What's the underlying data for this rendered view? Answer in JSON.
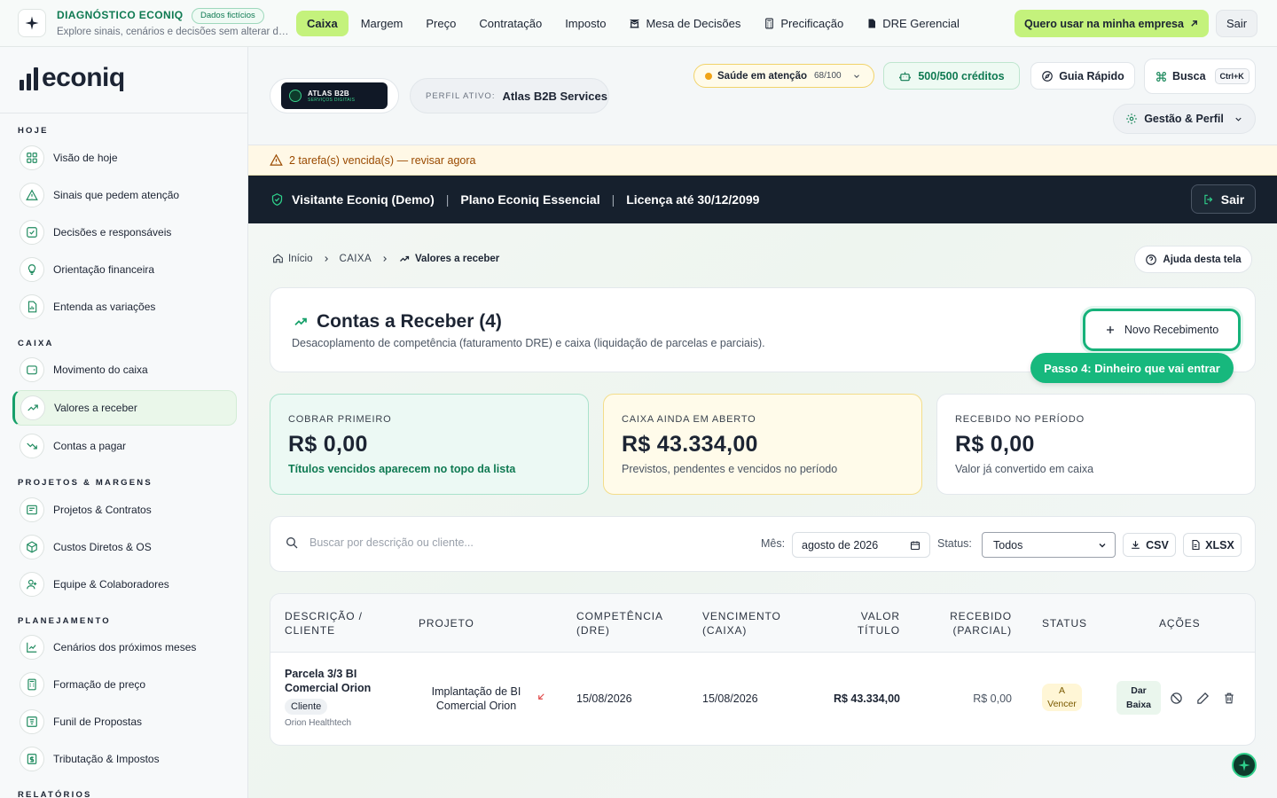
{
  "demo": {
    "title": "DIAGNÓSTICO ECONIQ",
    "badge": "Dados fictícios",
    "subtitle": "Explore sinais, cenários e decisões sem alterar da..."
  },
  "topnav": {
    "items": [
      {
        "label": "Caixa",
        "active": true
      },
      {
        "label": "Margem"
      },
      {
        "label": "Preço"
      },
      {
        "label": "Contratação"
      },
      {
        "label": "Imposto"
      },
      {
        "label": "Mesa de Decisões",
        "icon": "board-icon"
      },
      {
        "label": "Precificação",
        "icon": "calculator-icon"
      },
      {
        "label": "DRE Gerencial",
        "icon": "document-icon"
      }
    ],
    "cta": "Quero usar na minha empresa",
    "logout": "Sair"
  },
  "brand": {
    "name": "econiq"
  },
  "sidebar": {
    "sections": [
      {
        "label": "HOJE",
        "items": [
          {
            "label": "Visão de hoje",
            "icon": "grid-icon"
          },
          {
            "label": "Sinais que pedem atenção",
            "icon": "warning-icon"
          },
          {
            "label": "Decisões e responsáveis",
            "icon": "checkbox-icon"
          },
          {
            "label": "Orientação financeira",
            "icon": "lightbulb-icon"
          },
          {
            "label": "Entenda as variações",
            "icon": "file-chart-icon"
          }
        ]
      },
      {
        "label": "CAIXA",
        "items": [
          {
            "label": "Movimento do caixa",
            "icon": "wallet-icon"
          },
          {
            "label": "Valores a receber",
            "icon": "trend-up-icon",
            "active": true
          },
          {
            "label": "Contas a pagar",
            "icon": "trend-down-icon"
          }
        ]
      },
      {
        "label": "PROJETOS & MARGENS",
        "items": [
          {
            "label": "Projetos & Contratos",
            "icon": "contract-icon"
          },
          {
            "label": "Custos Diretos & OS",
            "icon": "box-icon"
          },
          {
            "label": "Equipe & Colaboradores",
            "icon": "user-icon"
          }
        ]
      },
      {
        "label": "PLANEJAMENTO",
        "items": [
          {
            "label": "Cenários dos próximos meses",
            "icon": "line-chart-icon"
          },
          {
            "label": "Formação de preço",
            "icon": "calculator-icon"
          },
          {
            "label": "Funil de Propostas",
            "icon": "funnel-icon"
          },
          {
            "label": "Tributação & Impostos",
            "icon": "tax-icon"
          }
        ]
      },
      {
        "label": "RELATÓRIOS",
        "items": []
      }
    ]
  },
  "header": {
    "company_logo_name": "ATLAS B2B",
    "company_logo_sub": "SERVIÇOS DIGITAIS",
    "profile_label": "PERFIL ATIVO:",
    "profile_value": "Atlas B2B Services",
    "health_label": "Saúde em atenção",
    "health_score": "68/100",
    "credits": "500/500 créditos",
    "guide": "Guia Rápido",
    "search": "Busca",
    "search_shortcut": "Ctrl+K",
    "manage": "Gestão & Perfil"
  },
  "alerts": {
    "overdue": "2 tarefa(s) vencida(s) — revisar agora",
    "visitor": "Visitante Econiq (Demo)",
    "plan": "Plano Econiq Essencial",
    "license": "Licença até 30/12/2099",
    "logout": "Sair"
  },
  "breadcrumb": {
    "home": "Início",
    "section": "CAIXA",
    "current": "Valores a receber",
    "help": "Ajuda desta tela"
  },
  "page": {
    "title": "Contas a Receber (4)",
    "description": "Desacoplamento de competência (faturamento DRE) e caixa (liquidação de parcelas e parciais).",
    "new_button": "Novo Recebimento",
    "step_tip": "Passo 4: Dinheiro que vai entrar"
  },
  "kpis": [
    {
      "label": "COBRAR PRIMEIRO",
      "value": "R$ 0,00",
      "sub": "Títulos vencidos aparecem no topo da lista"
    },
    {
      "label": "CAIXA AINDA EM ABERTO",
      "value": "R$ 43.334,00",
      "sub": "Previstos, pendentes e vencidos no período"
    },
    {
      "label": "RECEBIDO NO PERÍODO",
      "value": "R$ 0,00",
      "sub": "Valor já convertido em caixa"
    }
  ],
  "filters": {
    "search_placeholder": "Buscar por descrição ou cliente...",
    "month_label": "Mês:",
    "month_value": "agosto de 2026",
    "status_label": "Status:",
    "status_value": "Todos",
    "csv": "CSV",
    "xlsx": "XLSX"
  },
  "table": {
    "headers": {
      "desc_1": "DESCRIÇÃO /",
      "desc_2": "CLIENTE",
      "project": "PROJETO",
      "comp_1": "COMPETÊNCIA",
      "comp_2": "(DRE)",
      "due_1": "VENCIMENTO",
      "due_2": "(CAIXA)",
      "value_1": "VALOR",
      "value_2": "TÍTULO",
      "recv_1": "RECEBIDO",
      "recv_2": "(PARCIAL)",
      "status": "STATUS",
      "actions": "AÇÕES"
    },
    "rows": [
      {
        "desc_1": "Parcela 3/3 BI",
        "desc_2": "Comercial Orion",
        "tag": "Cliente",
        "client": "Orion Healthtech",
        "project_1": "Implantação de BI",
        "project_2": "Comercial Orion",
        "competence": "15/08/2026",
        "due": "15/08/2026",
        "value": "R$ 43.334,00",
        "received": "R$ 0,00",
        "status_1": "A",
        "status_2": "Vencer",
        "action_1": "Dar",
        "action_2": "Baixa"
      }
    ]
  },
  "colors": {
    "accent_lime": "#c4f27c",
    "brand_green": "#16b27a",
    "dark_banner": "#16202d",
    "warning": "#f0a316"
  }
}
